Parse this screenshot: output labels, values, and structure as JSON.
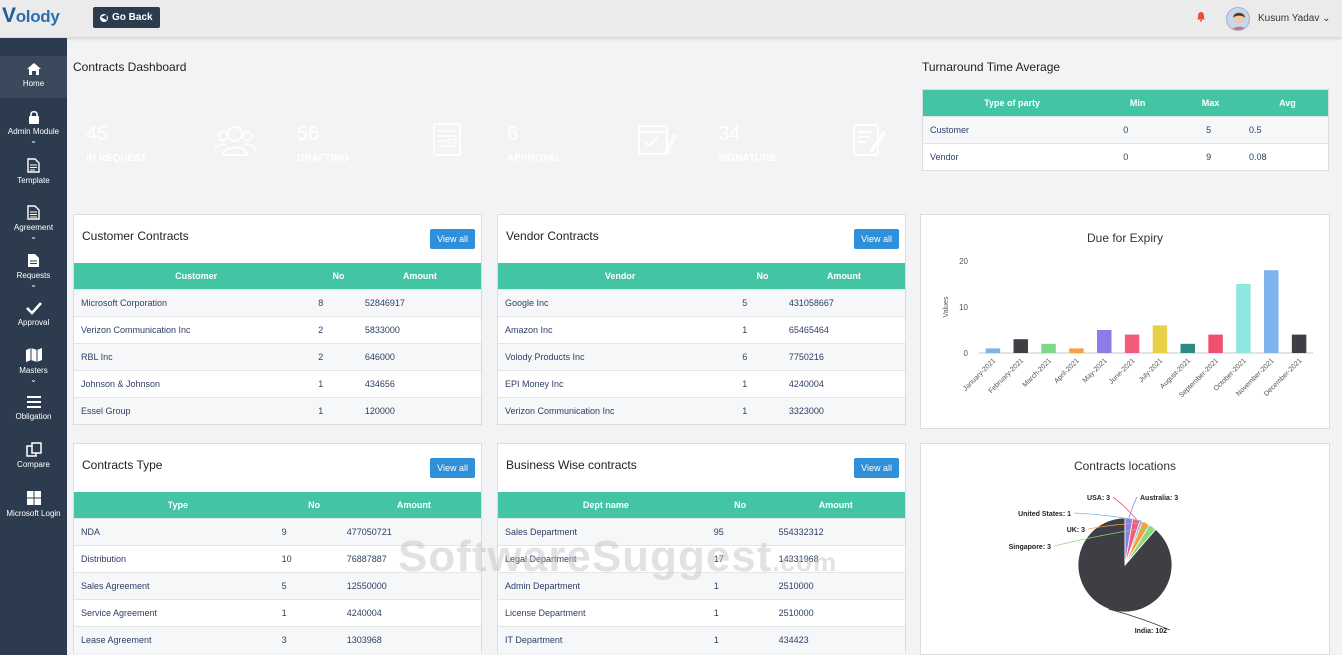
{
  "app": {
    "logo_text": "olody",
    "logo_initial": "V",
    "go_back": "Go Back",
    "username": "Kusum Yadav"
  },
  "sidebar": {
    "items": [
      {
        "label": "Home",
        "icon": "home-icon"
      },
      {
        "label": "Admin Module",
        "icon": "lock-icon"
      },
      {
        "label": "Template",
        "icon": "file-icon"
      },
      {
        "label": "Agreement",
        "icon": "document-icon"
      },
      {
        "label": "Requests",
        "icon": "requests-icon"
      },
      {
        "label": "Approval",
        "icon": "check-icon"
      },
      {
        "label": "Masters",
        "icon": "map-icon"
      },
      {
        "label": "Obligation",
        "icon": "list-icon"
      },
      {
        "label": "Compare",
        "icon": "compare-icon"
      },
      {
        "label": "Microsoft Login",
        "icon": "windows-icon"
      }
    ]
  },
  "dashboard": {
    "title": "Contracts Dashboard"
  },
  "stats": [
    {
      "value": "45",
      "label": "IN REQUEST",
      "color": "#e5232a"
    },
    {
      "value": "56",
      "label": "DRAFTING",
      "color": "#2b96ee"
    },
    {
      "value": "6",
      "label": "APPROVAL",
      "color": "#3db948"
    },
    {
      "value": "34",
      "label": "SIGNATURE",
      "color": "#f18b10"
    }
  ],
  "turnaround": {
    "title": "Turnaround Time Average",
    "headers": [
      "Type of party",
      "Min",
      "Max",
      "Avg"
    ],
    "rows": [
      [
        "Customer",
        "0",
        "5",
        "0.5"
      ],
      [
        "Vendor",
        "0",
        "9",
        "0.08"
      ]
    ]
  },
  "customer_contracts": {
    "title": "Customer Contracts",
    "view_all": "View all",
    "headers": [
      "Customer",
      "No",
      "Amount"
    ],
    "rows": [
      [
        "Microsoft Corporation",
        "8",
        "52846917"
      ],
      [
        "Verizon Communication Inc",
        "2",
        "5833000"
      ],
      [
        "RBL Inc",
        "2",
        "646000"
      ],
      [
        "Johnson & Johnson",
        "1",
        "434656"
      ],
      [
        "Essel Group",
        "1",
        "120000"
      ]
    ]
  },
  "vendor_contracts": {
    "title": "Vendor Contracts",
    "view_all": "View all",
    "headers": [
      "Vendor",
      "No",
      "Amount"
    ],
    "rows": [
      [
        "Google Inc",
        "5",
        "431058667"
      ],
      [
        "Amazon Inc",
        "1",
        "65465464"
      ],
      [
        "Volody Products Inc",
        "6",
        "7750216"
      ],
      [
        "EPI Money Inc",
        "1",
        "4240004"
      ],
      [
        "Verizon Communication Inc",
        "1",
        "3323000"
      ]
    ]
  },
  "contracts_type": {
    "title": "Contracts Type",
    "view_all": "View all",
    "headers": [
      "Type",
      "No",
      "Amount"
    ],
    "rows": [
      [
        "NDA",
        "9",
        "477050721"
      ],
      [
        "Distribution",
        "10",
        "76887887"
      ],
      [
        "Sales Agreement",
        "5",
        "12550000"
      ],
      [
        "Service Agreement",
        "1",
        "4240004"
      ],
      [
        "Lease Agreement",
        "3",
        "1303968"
      ]
    ]
  },
  "business_wise": {
    "title": "Business Wise contracts",
    "view_all": "View all",
    "headers": [
      "Dept name",
      "No",
      "Amount"
    ],
    "rows": [
      [
        "Sales Department",
        "95",
        "554332312"
      ],
      [
        "Legal Department",
        "17",
        "14331968"
      ],
      [
        "Admin Department",
        "1",
        "2510000"
      ],
      [
        "License Department",
        "1",
        "2510000"
      ],
      [
        "IT Department",
        "1",
        "434423"
      ]
    ]
  },
  "watermark": {
    "text": "SoftwareSuggest",
    "suffix": ".com"
  },
  "chart_data": [
    {
      "type": "bar",
      "title": "Due for Expiry",
      "ylabel": "Values",
      "ylim": [
        0,
        20
      ],
      "yticks": [
        0,
        10,
        20
      ],
      "categories": [
        "January-2021",
        "February-2021",
        "March-2021",
        "April-2021",
        "May-2021",
        "June-2021",
        "July-2021",
        "August-2021",
        "September-2021",
        "October-2021",
        "November-2021",
        "December-2021"
      ],
      "values": [
        1,
        3,
        2,
        1,
        5,
        4,
        6,
        2,
        4,
        15,
        18,
        4
      ],
      "colors": [
        "#7fb3ea",
        "#3d3f44",
        "#7ed88c",
        "#f5a142",
        "#8b7ce8",
        "#f25b7b",
        "#e8d14a",
        "#2e8b84",
        "#f0506e",
        "#8ee8df",
        "#7cb4ee",
        "#3d3f44"
      ],
      "grid": false,
      "legend": "none"
    },
    {
      "type": "pie",
      "title": "Contracts locations",
      "labels": [
        "India",
        "Singapore",
        "UK",
        "United States",
        "USA",
        "Australia"
      ],
      "values": [
        102,
        3,
        3,
        1,
        3,
        3
      ],
      "colors": [
        "#3d3f44",
        "#8ed881",
        "#f5a142",
        "#7cb4ee",
        "#f25b7b",
        "#8b7ce8"
      ]
    }
  ]
}
